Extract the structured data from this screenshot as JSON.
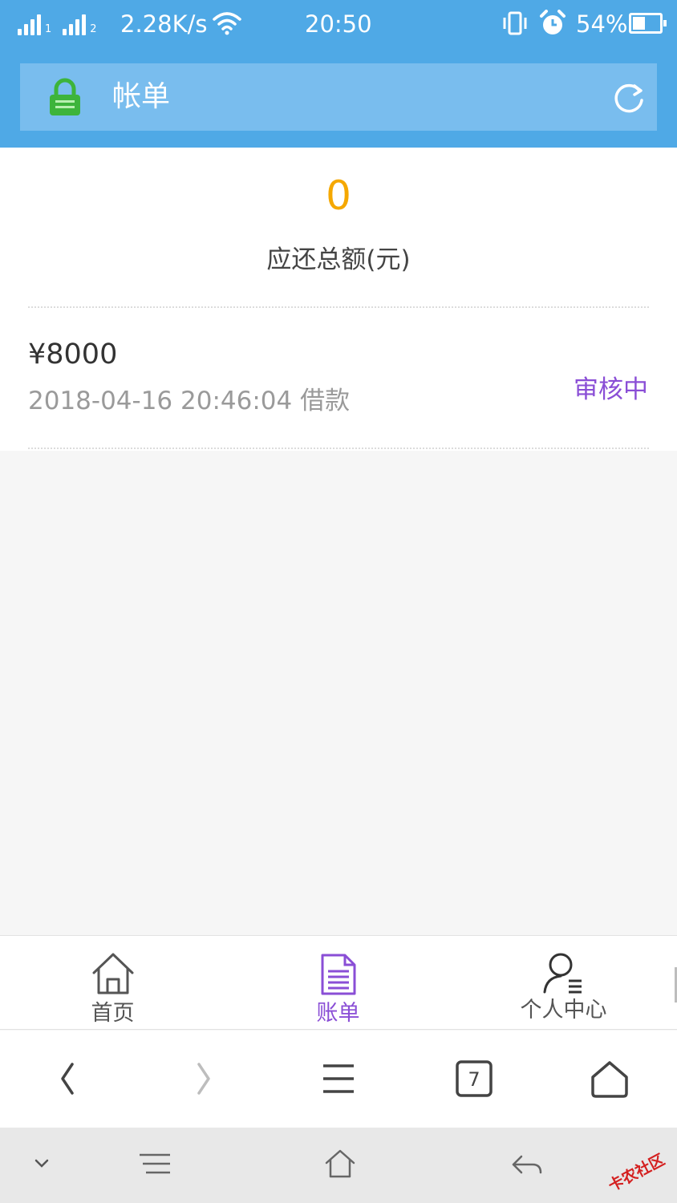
{
  "status_bar": {
    "sim1_label": "1",
    "sim2_label": "2",
    "network_speed": "2.28K/s",
    "time": "20:50",
    "battery_percent": "54%",
    "battery_level": 0.54,
    "icons": [
      "signal-icon",
      "wifi-icon",
      "vibrate-icon",
      "alarm-icon",
      "battery-icon"
    ]
  },
  "header": {
    "title": "帐单",
    "left_icon": "lock-icon",
    "right_icon": "refresh-icon",
    "colors": {
      "bar": "#4fa9e6",
      "title_bg": "#79bdee"
    }
  },
  "summary": {
    "total_amount": "0",
    "total_label": "应还总额(元)",
    "amount_color": "#f5a800"
  },
  "bills": [
    {
      "amount": "¥8000",
      "meta": "2018-04-16 20:46:04 借款",
      "status": "审核中",
      "status_color": "#8a4ed6"
    }
  ],
  "tabbar": {
    "tabs": [
      {
        "label": "首页",
        "icon": "home-icon",
        "active": false
      },
      {
        "label": "账单",
        "icon": "bill-document-icon",
        "active": true
      },
      {
        "label": "个人中心",
        "icon": "profile-icon",
        "active": false
      }
    ],
    "active_color": "#8a4ed6"
  },
  "browser_toolbar": {
    "tab_count": "7",
    "buttons": [
      "back-icon",
      "forward-icon",
      "menu-icon",
      "tabs-icon",
      "home-icon"
    ]
  },
  "system_nav": {
    "buttons": [
      "collapse-icon",
      "recent-apps-icon",
      "home-icon",
      "back-icon"
    ]
  },
  "watermark": {
    "text": "卡农社区"
  }
}
